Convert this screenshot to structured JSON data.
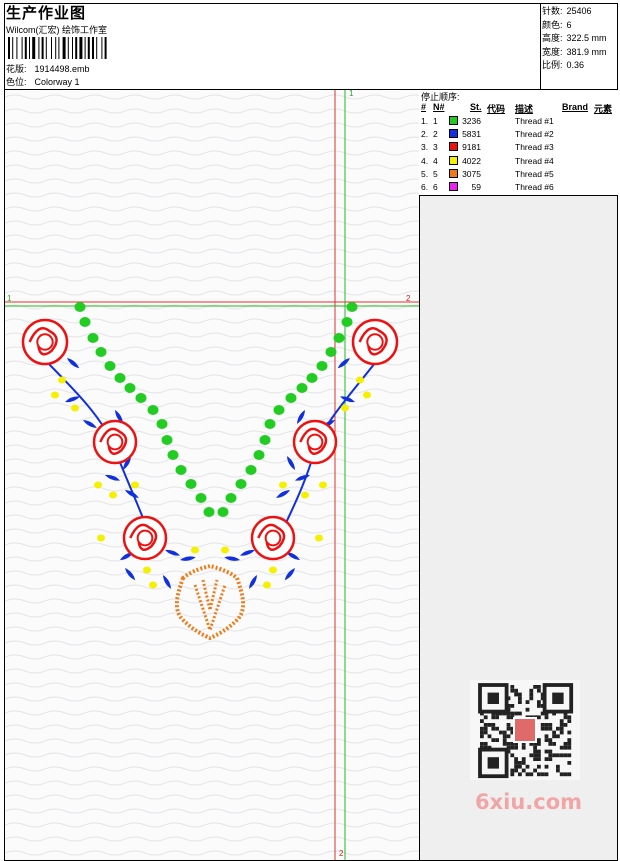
{
  "header": {
    "title": "生产作业图",
    "software": "Wilcom(汇宏) 绘饰工作室",
    "design_label": "花版:",
    "design_file": "1914498.emb",
    "colorway_label": "色位:",
    "colorway": "Colorway 1"
  },
  "stats": [
    {
      "label": "针数:",
      "value": "25406"
    },
    {
      "label": "颜色:",
      "value": "6"
    },
    {
      "label": "高度:",
      "value": "322.5 mm"
    },
    {
      "label": "宽度:",
      "value": "381.9 mm"
    },
    {
      "label": "比例:",
      "value": "0.36"
    }
  ],
  "stop_sequence": {
    "title": "停止顺序:",
    "headers": {
      "num": "#",
      "n": "N#",
      "st": "St.",
      "code": "代码",
      "desc": "描述",
      "brand": "Brand",
      "element": "元素"
    },
    "rows": [
      {
        "num": "1.",
        "n": "1",
        "code": "3236",
        "desc": "Thread #1",
        "color": "#22cc22"
      },
      {
        "num": "2.",
        "n": "2",
        "code": "5831",
        "desc": "Thread #2",
        "color": "#1030e0"
      },
      {
        "num": "3.",
        "n": "3",
        "code": "9181",
        "desc": "Thread #3",
        "color": "#ee1111"
      },
      {
        "num": "4.",
        "n": "4",
        "code": "4022",
        "desc": "Thread #4",
        "color": "#f5f000"
      },
      {
        "num": "5.",
        "n": "5",
        "code": "3075",
        "desc": "Thread #5",
        "color": "#f07a18"
      },
      {
        "num": "6.",
        "n": "6",
        "code": "59",
        "desc": "Thread #6",
        "color": "#ee22ee"
      }
    ]
  },
  "guides": {
    "v_top": "1",
    "v_bottom": "2",
    "h_left": "1",
    "h_right": "2"
  },
  "watermark": "6xiu.com",
  "colors": {
    "guide_red": "#e03030",
    "guide_green": "#22bb22",
    "panel_bg": "#efefef"
  }
}
